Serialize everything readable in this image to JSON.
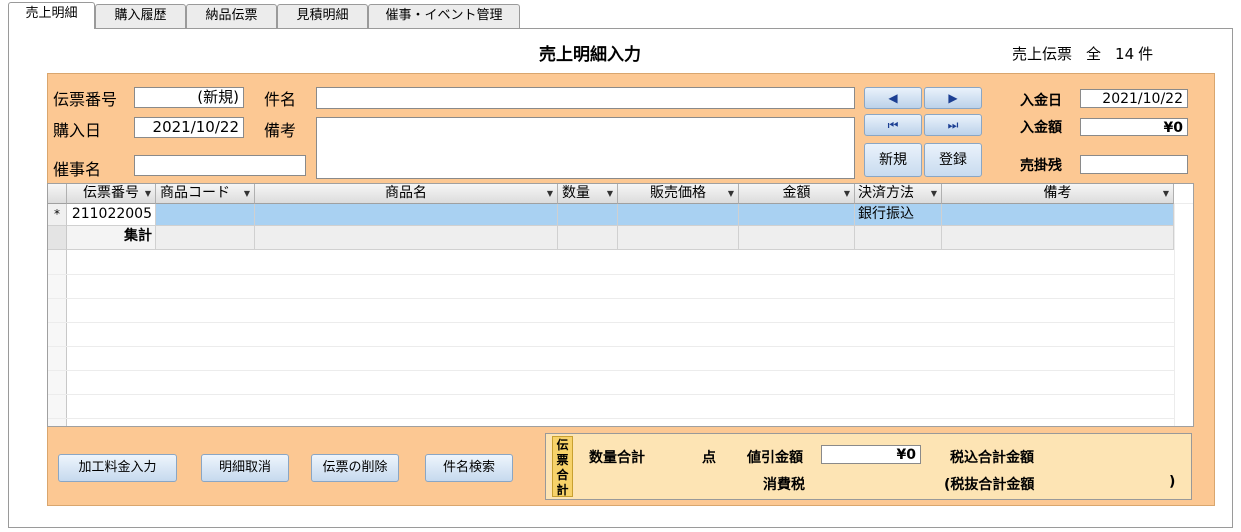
{
  "tabs": [
    "売上明細",
    "購入履歴",
    "納品伝票",
    "見積明細",
    "催事・イベント管理"
  ],
  "title": "売上明細入力",
  "record_count": {
    "label": "売上伝票",
    "all": "全",
    "count": "14",
    "unit": "件"
  },
  "form": {
    "slip_no_label": "伝票番号",
    "slip_no_value": "(新規)",
    "subject_label": "件名",
    "subject_value": "",
    "purchase_date_label": "購入日",
    "purchase_date_value": "2021/10/22",
    "remarks_label": "備考",
    "remarks_value": "",
    "event_label": "催事名",
    "event_value": "",
    "new_button": "新規",
    "register_button": "登録",
    "payment_date_label": "入金日",
    "payment_date_value": "2021/10/22",
    "payment_amount_label": "入金額",
    "payment_amount_value": "¥0",
    "receivable_label": "売掛残",
    "receivable_value": ""
  },
  "nav": {
    "prev": "◀",
    "next": "▶",
    "first": "⏮",
    "last": "⏭"
  },
  "table": {
    "columns": [
      "伝票番号",
      "商品コード",
      "商品名",
      "数量",
      "販売価格",
      "金額",
      "決済方法",
      "備考"
    ],
    "new_row_marker": "*",
    "rows": [
      {
        "slip_no": "211022005",
        "code": "",
        "name": "",
        "qty": "",
        "price": "",
        "amount": "",
        "payment": "銀行振込",
        "note": ""
      }
    ],
    "summary_label": "集計"
  },
  "buttons": {
    "processing_fee": "加工料金入力",
    "cancel_detail": "明細取消",
    "delete_slip": "伝票の削除",
    "search_subject": "件名検索"
  },
  "totals": {
    "side_label": [
      "伝",
      "票",
      "合",
      "計"
    ],
    "qty_total_label": "数量合計",
    "qty_unit": "点",
    "discount_label": "値引金額",
    "discount_value": "¥0",
    "tax_incl_label": "税込合計金額",
    "tax_label": "消費税",
    "tax_excl_label": "(税抜合計金額",
    "tax_excl_close": ")"
  },
  "colors": {
    "panel": "#fcc893",
    "selected_row": "#a9d1f2",
    "totals_bg": "#fde4b4"
  }
}
